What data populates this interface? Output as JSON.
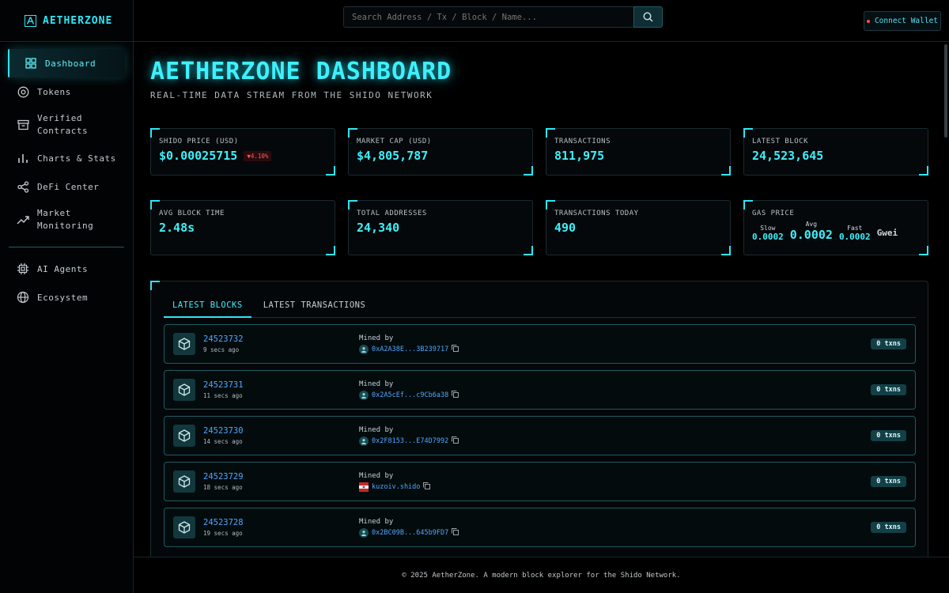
{
  "brand": {
    "name": "AETHERZONE",
    "logo_glyph": "A"
  },
  "sidebar": {
    "items": [
      {
        "label": "Dashboard",
        "icon": "grid-icon",
        "active": true
      },
      {
        "label": "Tokens",
        "icon": "token-icon"
      },
      {
        "label": "Verified Contracts",
        "icon": "archive-icon"
      },
      {
        "label": "Charts & Stats",
        "icon": "bar-chart-icon"
      },
      {
        "label": "DeFi Center",
        "icon": "share-icon"
      },
      {
        "label": "Market Monitoring",
        "icon": "trending-icon"
      }
    ],
    "secondary": [
      {
        "label": "AI Agents",
        "icon": "chip-icon"
      },
      {
        "label": "Ecosystem",
        "icon": "globe-icon"
      }
    ]
  },
  "header": {
    "search_placeholder": "Search Address / Tx / Block / Name...",
    "wallet_label": "Connect Wallet"
  },
  "main": {
    "title": "AETHERZONE DASHBOARD",
    "subtitle": "REAL-TIME DATA STREAM FROM THE SHIDO NETWORK"
  },
  "stats": {
    "price": {
      "label": "SHIDO PRICE (USD)",
      "value": "$0.00025715",
      "change": "▼4.10%"
    },
    "market_cap": {
      "label": "MARKET CAP (USD)",
      "value": "$4,805,787"
    },
    "transactions": {
      "label": "TRANSACTIONS",
      "value": "811,975"
    },
    "latest_block": {
      "label": "LATEST BLOCK",
      "value": "24,523,645"
    },
    "avg_block_time": {
      "label": "AVG BLOCK TIME",
      "value": "2.48s"
    },
    "total_addresses": {
      "label": "TOTAL ADDRESSES",
      "value": "24,340"
    },
    "transactions_today": {
      "label": "TRANSACTIONS TODAY",
      "value": "490"
    },
    "gas": {
      "label": "GAS PRICE",
      "slow_label": "Slow",
      "slow": "0.0002",
      "avg_label": "Avg",
      "avg": "0.0002",
      "fast_label": "Fast",
      "fast": "0.0002",
      "unit": "Gwei"
    }
  },
  "tabs": [
    {
      "label": "LATEST BLOCKS",
      "active": true
    },
    {
      "label": "LATEST TRANSACTIONS",
      "active": false
    }
  ],
  "blocks": [
    {
      "number": "24523732",
      "age": "9 secs ago",
      "mined_label": "Mined by",
      "miner": "0xA2A38E...3B239717",
      "txns": "0 txns"
    },
    {
      "number": "24523731",
      "age": "11 secs ago",
      "mined_label": "Mined by",
      "miner": "0x2A5cEf...c9Cb6a38",
      "txns": "0 txns"
    },
    {
      "number": "24523730",
      "age": "14 secs ago",
      "mined_label": "Mined by",
      "miner": "0x2F8153...E74D7992",
      "txns": "0 txns"
    },
    {
      "number": "24523729",
      "age": "18 secs ago",
      "mined_label": "Mined by",
      "miner": "kuzoiv.shido",
      "txns": "0 txns"
    },
    {
      "number": "24523728",
      "age": "19 secs ago",
      "mined_label": "Mined by",
      "miner": "0x2BC09B...645b9FD7",
      "txns": "0 txns"
    }
  ],
  "footer": {
    "text": "© 2025 AetherZone. A modern block explorer for the Shido Network."
  },
  "colors": {
    "accent": "#2ee6f6",
    "link": "#4ea8ff",
    "negative": "#ff5a5a"
  }
}
